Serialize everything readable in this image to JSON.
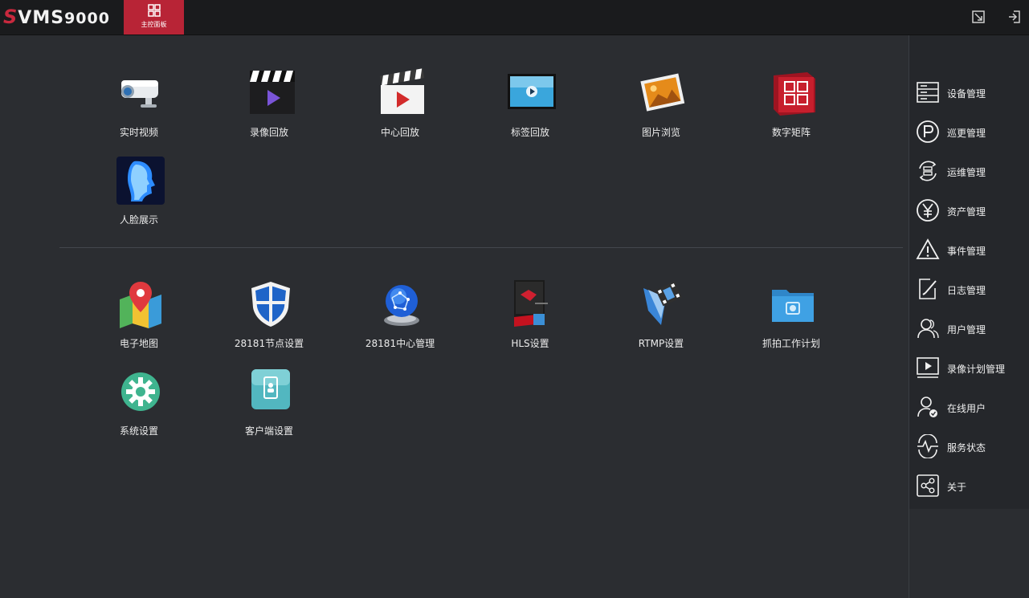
{
  "app": {
    "logo_s": "S",
    "logo_vms": "VMS",
    "logo_num": "9000",
    "home_tab_label": "主控面板"
  },
  "colors": {
    "accent": "#b82436",
    "topbar": "#1a1b1d",
    "background": "#2b2d31"
  },
  "toolbar": {
    "fullscreen_icon": "resize-icon",
    "exit_icon": "logout-icon"
  },
  "modules_top": [
    {
      "label": "实时视频",
      "icon": "cctv-camera-icon"
    },
    {
      "label": "录像回放",
      "icon": "clapperboard-play-icon"
    },
    {
      "label": "中心回放",
      "icon": "clapperboard-red-play-icon"
    },
    {
      "label": "标签回放",
      "icon": "monitor-play-icon"
    },
    {
      "label": "图片浏览",
      "icon": "photo-icon"
    },
    {
      "label": "数字矩阵",
      "icon": "matrix-cube-icon"
    },
    {
      "label": "人脸展示",
      "icon": "face-profile-icon"
    }
  ],
  "modules_bottom": [
    {
      "label": "电子地图",
      "icon": "map-pin-icon"
    },
    {
      "label": "28181节点设置",
      "icon": "shield-icon"
    },
    {
      "label": "28181中心管理",
      "icon": "globe-network-icon"
    },
    {
      "label": "HLS设置",
      "icon": "hls-device-icon"
    },
    {
      "label": "RTMP设置",
      "icon": "rtmp-film-icon"
    },
    {
      "label": "抓拍工作计划",
      "icon": "folder-camera-icon"
    },
    {
      "label": "系统设置",
      "icon": "gear-icon"
    },
    {
      "label": "客户端设置",
      "icon": "client-tablet-icon"
    }
  ],
  "sidebar": {
    "items": [
      {
        "label": "设备管理",
        "icon": "server-rack-icon"
      },
      {
        "label": "巡更管理",
        "icon": "patrol-p-icon"
      },
      {
        "label": "运维管理",
        "icon": "maintenance-cycle-icon"
      },
      {
        "label": "资产管理",
        "icon": "yen-coin-icon"
      },
      {
        "label": "事件管理",
        "icon": "warning-triangle-icon"
      },
      {
        "label": "日志管理",
        "icon": "log-edit-icon"
      },
      {
        "label": "用户管理",
        "icon": "users-icon"
      },
      {
        "label": "录像计划管理",
        "icon": "record-plan-icon"
      },
      {
        "label": "在线用户",
        "icon": "online-user-icon"
      },
      {
        "label": "服务状态",
        "icon": "service-pulse-icon"
      },
      {
        "label": "关于",
        "icon": "share-about-icon"
      }
    ]
  }
}
